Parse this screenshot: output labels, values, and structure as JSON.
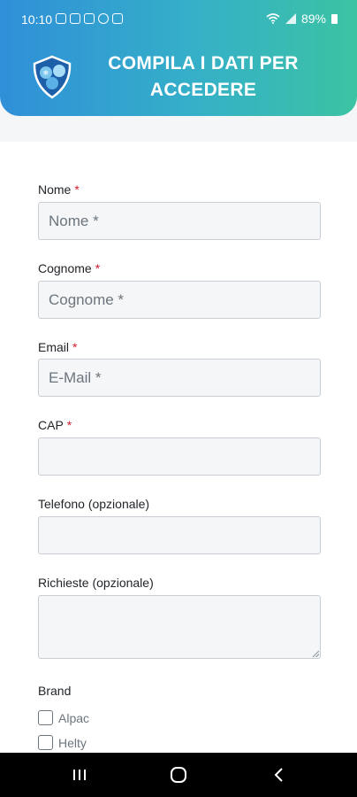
{
  "statusbar": {
    "time": "10:10",
    "battery": "89%",
    "icons": [
      "instagram-icon",
      "calendar-icon",
      "mail-icon",
      "smile-icon",
      "gallery-icon"
    ]
  },
  "header": {
    "title": "COMPILA I DATI PER ACCEDERE",
    "logo": "shield-logo-icon"
  },
  "form": {
    "fields": [
      {
        "label": "Nome",
        "required": "*",
        "placeholder": "Nome *",
        "value": ""
      },
      {
        "label": "Cognome",
        "required": "*",
        "placeholder": "Cognome *",
        "value": ""
      },
      {
        "label": "Email",
        "required": "*",
        "placeholder": "E-Mail *",
        "value": ""
      },
      {
        "label": "CAP",
        "required": "*",
        "placeholder": "",
        "value": ""
      },
      {
        "label": "Telefono (opzionale)",
        "placeholder": "",
        "value": ""
      },
      {
        "label": "Richieste (opzionale)",
        "placeholder": "",
        "value": ""
      }
    ],
    "brand": {
      "label": "Brand",
      "options": [
        {
          "label": "Alpac",
          "checked": false
        },
        {
          "label": "Helty",
          "checked": false
        }
      ]
    }
  },
  "navbar": {
    "icons": [
      "recent-apps-icon",
      "home-icon",
      "back-icon"
    ]
  },
  "colors": {
    "header_gradient_start": "#2f8fd8",
    "header_gradient_end": "#3cc3a3",
    "required": "#d11a2a"
  }
}
